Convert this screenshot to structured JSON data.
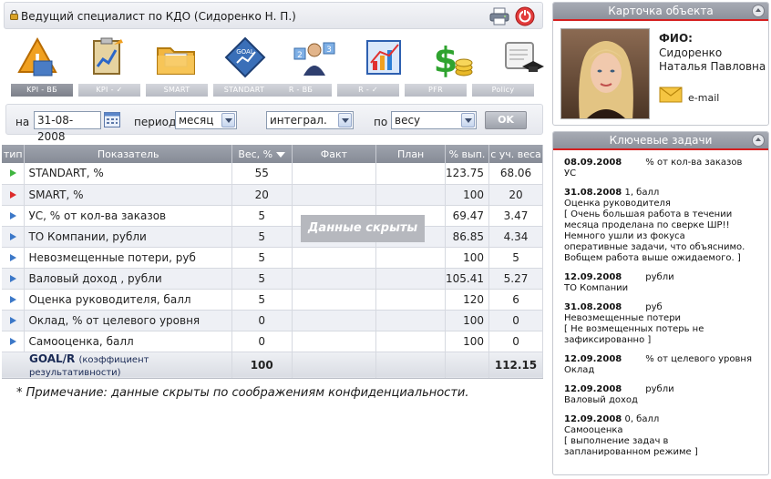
{
  "header": {
    "user_text": "Ведущий специалист по КДО  (Сидоренко Н. П.)"
  },
  "tabs": [
    {
      "label": "KPI - ВБ",
      "active": true
    },
    {
      "label": "KPI - ✓",
      "active": false
    },
    {
      "label": "SMART",
      "active": false
    },
    {
      "label": "STANDART",
      "active": false
    },
    {
      "label": "R - ВБ",
      "active": false
    },
    {
      "label": "R - ✓",
      "active": false
    },
    {
      "label": "PFR",
      "active": false
    },
    {
      "label": "Policy",
      "active": false
    }
  ],
  "filters": {
    "date_label": "на",
    "date_value": "31-08-2008",
    "period_label": "период",
    "period_value": "месяц",
    "calc_value": "интеграл.",
    "by_label": "по",
    "by_value": "весу",
    "ok_label": "OK"
  },
  "table": {
    "headers": {
      "type": "тип",
      "name": "Показатель",
      "weight": "Вес, %",
      "fact": "Факт",
      "plan": "План",
      "pct": "% вып.",
      "weighted": "с уч. веса"
    },
    "rows": [
      {
        "color": "green",
        "name": "STANDART, %",
        "weight": "55",
        "pct": "123.75",
        "weighted": "68.06"
      },
      {
        "color": "red",
        "name": "SMART, %",
        "weight": "20",
        "pct": "100",
        "weighted": "20"
      },
      {
        "color": "blue",
        "name": "УС, % от кол-ва заказов",
        "weight": "5",
        "pct": "69.47",
        "weighted": "3.47"
      },
      {
        "color": "blue",
        "name": "ТО Компании, рубли",
        "weight": "5",
        "pct": "86.85",
        "weighted": "4.34"
      },
      {
        "color": "blue",
        "name": "Невозмещенные потери, руб",
        "weight": "5",
        "pct": "100",
        "weighted": "5"
      },
      {
        "color": "blue",
        "name": "Валовый доход , рубли",
        "weight": "5",
        "pct": "105.41",
        "weighted": "5.27"
      },
      {
        "color": "blue",
        "name": "Оценка руководителя, балл",
        "weight": "5",
        "pct": "120",
        "weighted": "6"
      },
      {
        "color": "blue",
        "name": "Оклад, % от целевого уровня",
        "weight": "0",
        "pct": "100",
        "weighted": "0"
      },
      {
        "color": "blue",
        "name": "Самооценка, балл",
        "weight": "0",
        "pct": "100",
        "weighted": "0"
      }
    ],
    "total": {
      "label": "GOAL/R",
      "sub": "(коэффициент результативности)",
      "weight": "100",
      "weighted": "112.15"
    },
    "hidden_badge": "Данные скрыты"
  },
  "note": "* Примечание: данные скрыты по соображениям конфиденциальности.",
  "card": {
    "title": "Карточка объекта",
    "fio_label": "ФИО:",
    "fio": "Сидоренко Наталья Павловна",
    "email_label": "e-mail"
  },
  "tasks": {
    "title": "Ключевые задачи",
    "items": [
      {
        "date": "08.09.2008",
        "extra": "",
        "unit": "% от кол-ва заказов",
        "name": "УС",
        "comment": ""
      },
      {
        "date": "31.08.2008",
        "extra": "1, балл",
        "unit": "",
        "name": "Оценка руководителя",
        "comment": "[ Очень большая работа в течении месяца проделана по сверке ШР!! Немного ушли из фокуса оперативные задачи, что объяснимо. Вобщем работа выше ожидаемого. ]"
      },
      {
        "date": "12.09.2008",
        "extra": "",
        "unit": "рубли",
        "name": "ТО Компании",
        "comment": ""
      },
      {
        "date": "31.08.2008",
        "extra": "",
        "unit": "руб",
        "name": "Невозмещенные потери",
        "comment": "[ Не возмещенных потерь не зафиксированно ]"
      },
      {
        "date": "12.09.2008",
        "extra": "",
        "unit": "% от целевого уровня",
        "name": "Оклад",
        "comment": ""
      },
      {
        "date": "12.09.2008",
        "extra": "",
        "unit": "рубли",
        "name": "Валовый доход",
        "comment": ""
      },
      {
        "date": "12.09.2008",
        "extra": "0, балл",
        "unit": "",
        "name": "Самооценка",
        "comment": "[ выполнение задач в запланированном режиме ]"
      }
    ]
  }
}
